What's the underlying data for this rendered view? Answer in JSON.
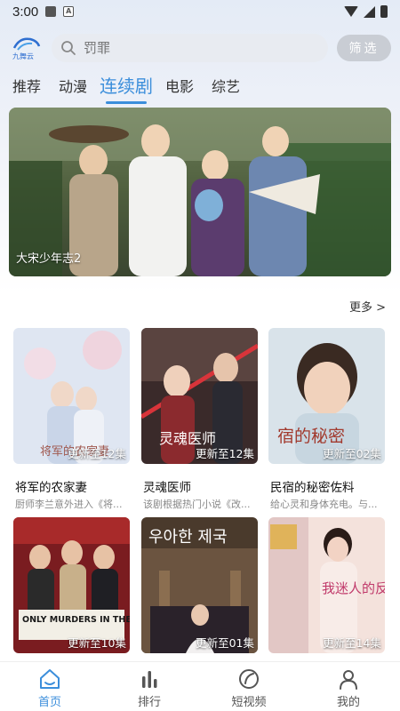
{
  "status_bar": {
    "time": "3:00"
  },
  "header": {
    "logo_text": "九舞云",
    "search_placeholder": "罚罪",
    "filter_label": "筛选"
  },
  "tabs": [
    {
      "label": "推荐",
      "active": false
    },
    {
      "label": "动漫",
      "active": false
    },
    {
      "label": "连续剧",
      "active": true
    },
    {
      "label": "电影",
      "active": false
    },
    {
      "label": "综艺",
      "active": false
    }
  ],
  "banner": {
    "title": "大宋少年志2"
  },
  "section": {
    "more_label": "更多 >"
  },
  "cards": [
    {
      "title": "将军的农家妻",
      "desc": "厨师李兰意外进入《将...",
      "badge": "更新至12集",
      "poster_text": "将军的农家妻"
    },
    {
      "title": "灵魂医师",
      "desc": "该剧根据热门小说《改...",
      "badge": "更新至12集",
      "poster_text": "灵魂医师"
    },
    {
      "title": "民宿的秘密佐料",
      "desc": "给心灵和身体充电。与...",
      "badge": "更新至02集",
      "poster_text": "宿的秘密"
    },
    {
      "title": "",
      "desc": "",
      "badge": "更新至10集",
      "poster_text": "ONLY MURDERS IN THE BUILDING"
    },
    {
      "title": "",
      "desc": "",
      "badge": "更新至01集",
      "poster_text": "우아한 제국"
    },
    {
      "title": "",
      "desc": "",
      "badge": "更新至14集",
      "poster_text": "我迷人的反派"
    }
  ],
  "bottom_nav": [
    {
      "label": "首页",
      "icon": "home-icon",
      "active": true
    },
    {
      "label": "排行",
      "icon": "ranking-icon",
      "active": false
    },
    {
      "label": "短视频",
      "icon": "short-video-icon",
      "active": false
    },
    {
      "label": "我的",
      "icon": "profile-icon",
      "active": false
    }
  ],
  "colors": {
    "accent": "#3b8edb",
    "filter_bg": "#c9cdd4",
    "search_bg": "#e8ebf1"
  }
}
